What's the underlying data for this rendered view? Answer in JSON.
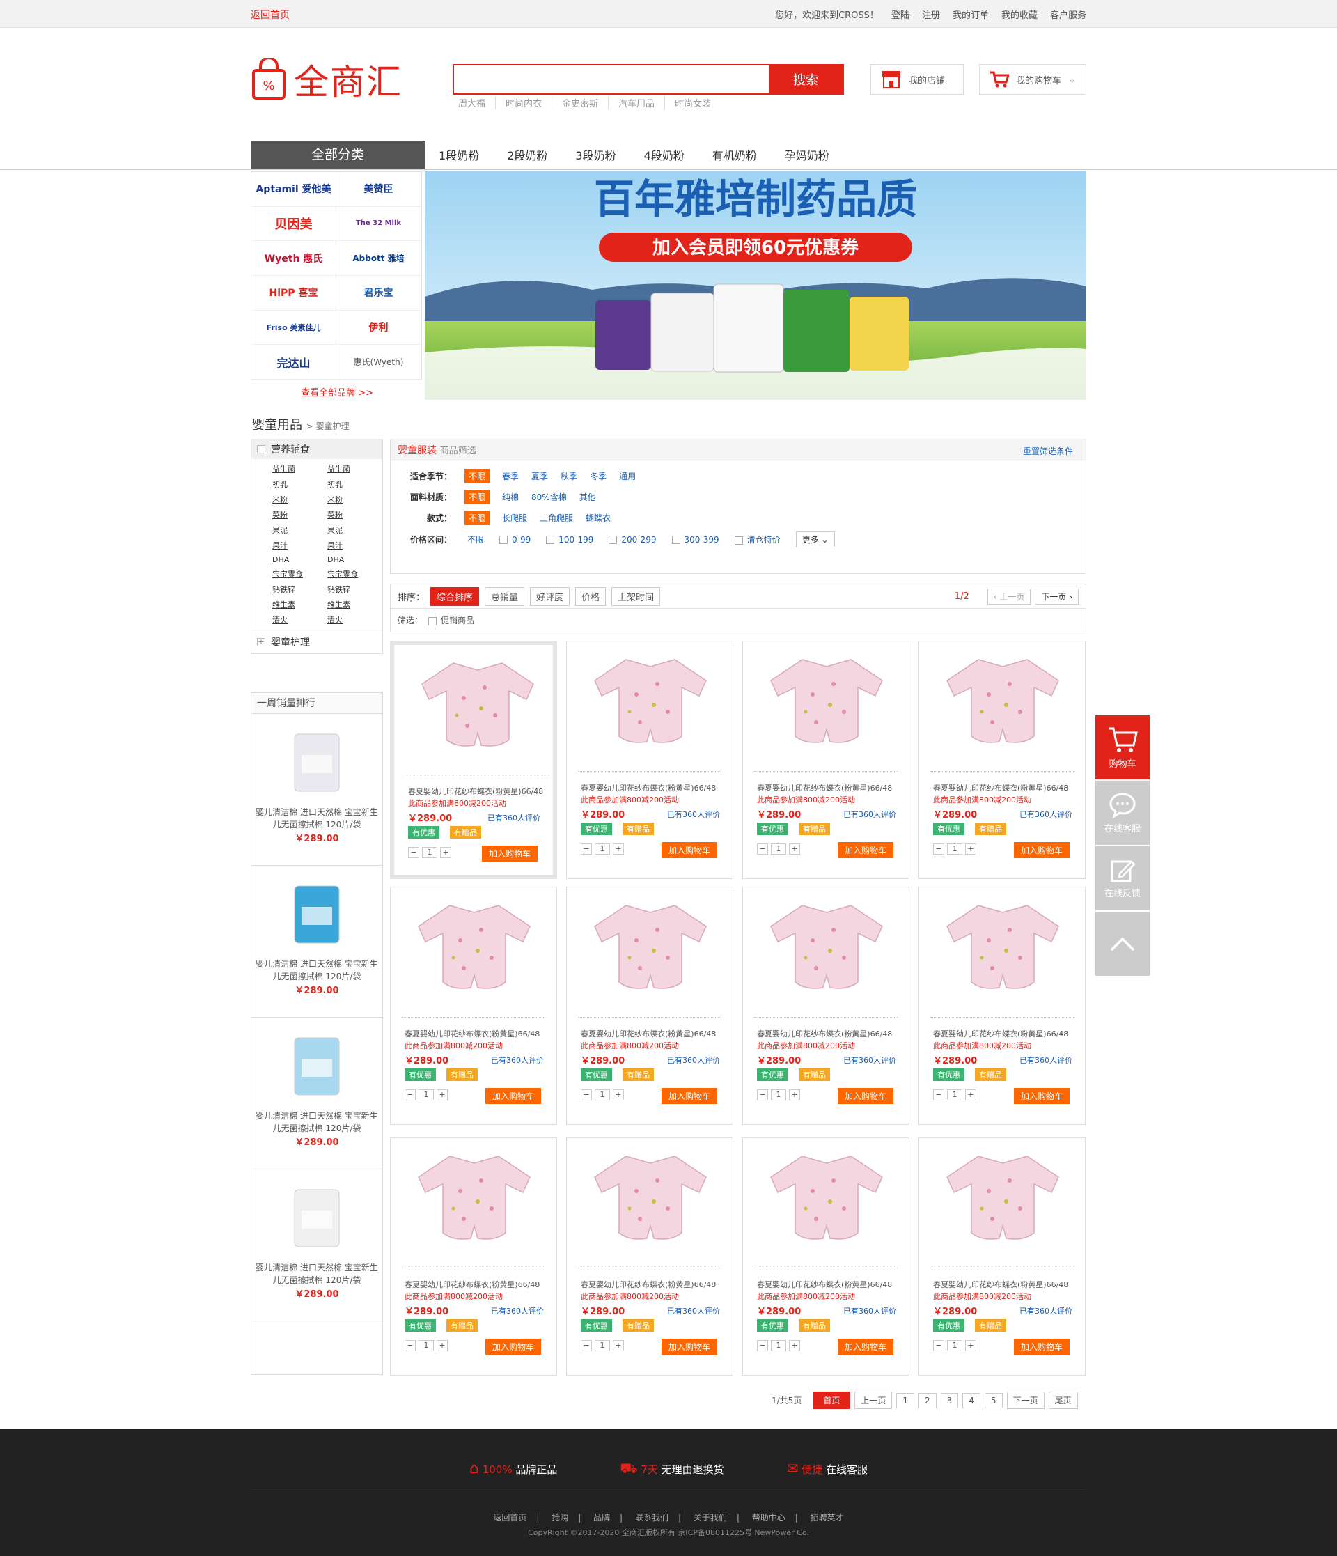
{
  "topbar": {
    "home": "返回首页",
    "welcome": "您好，欢迎来到CROSS！",
    "login": "登陆",
    "register": "注册",
    "orders": "我的订单",
    "favorites": "我的收藏",
    "service": "客户服务"
  },
  "header": {
    "logo": "全商汇",
    "search_button": "搜索",
    "search_placeholder": "",
    "hotwords": [
      "周大福",
      "时尚内衣",
      "金史密斯",
      "汽车用品",
      "时尚女装"
    ],
    "my_shop": "我的店铺",
    "my_cart": "我的购物车"
  },
  "nav": {
    "all": "全部分类",
    "items": [
      "1段奶粉",
      "2段奶粉",
      "3段奶粉",
      "4段奶粉",
      "有机奶粉",
      "孕妈奶粉"
    ]
  },
  "brands": {
    "items": [
      "Aptamil 爱他美",
      "美赞臣",
      "贝因美",
      "The 32 Milk",
      "Wyeth 惠氏",
      "Abbott 雅培",
      "HiPP 喜宝",
      "君乐宝",
      "Friso 美素佳儿",
      "伊利",
      "完达山",
      "惠氏(Wyeth)"
    ],
    "all": "查看全部品牌 >>"
  },
  "banner": {
    "title": "百年雅培制药品质",
    "subtitle": "加入会员即领60元优惠券"
  },
  "breadcrumb": {
    "main": "婴童用品",
    "sub": "婴童护理"
  },
  "leftcat": {
    "title1": "营养辅食",
    "items": [
      "益生菌",
      "益生菌",
      "初乳",
      "初乳",
      "米粉",
      "米粉",
      "菜粉",
      "菜粉",
      "果泥",
      "果泥",
      "果汁",
      "果汁",
      "DHA",
      "DHA",
      "宝宝零食",
      "宝宝零食",
      "钙铁锌",
      "钙铁锌",
      "维生素",
      "维生素",
      "清火",
      "清火"
    ],
    "title2": "婴童护理"
  },
  "rank": {
    "title": "一周销量排行",
    "items": [
      {
        "title": "婴儿清洁棉 进口天然棉 宝宝新生儿无菌擦拭棉 120片/袋",
        "price": "￥289.00"
      },
      {
        "title": "婴儿清洁棉 进口天然棉 宝宝新生儿无菌擦拭棉 120片/袋",
        "price": "￥289.00"
      },
      {
        "title": "婴儿清洁棉 进口天然棉 宝宝新生儿无菌擦拭棉 120片/袋",
        "price": "￥289.00"
      },
      {
        "title": "婴儿清洁棉 进口天然棉 宝宝新生儿无菌擦拭棉 120片/袋",
        "price": "￥289.00"
      }
    ]
  },
  "filter": {
    "title": "婴童服装",
    "subtitle": "-商品筛选",
    "reset": "重置筛选条件",
    "season": {
      "label": "适合季节：",
      "on": "不限",
      "opts": [
        "春季",
        "夏季",
        "秋季",
        "冬季",
        "通用"
      ]
    },
    "material": {
      "label": "面料材质：",
      "on": "不限",
      "opts": [
        "纯棉",
        "80%含棉",
        "其他"
      ]
    },
    "style": {
      "label": "款式：",
      "on": "不限",
      "opts": [
        "长爬服",
        "三角爬服",
        "蝴蝶衣"
      ]
    },
    "price": {
      "label": "价格区间：",
      "first": "不限",
      "opts": [
        "0-99",
        "100-199",
        "200-299",
        "300-399",
        "清仓特价"
      ],
      "more": "更多"
    }
  },
  "sort": {
    "label": "排序：",
    "opts": [
      "综合排序",
      "总销量",
      "好评度",
      "价格",
      "上架时间"
    ],
    "page": "1/2",
    "prev": "上一页",
    "next": "下一页",
    "screen_label": "筛选：",
    "promo": "促销商品"
  },
  "product": {
    "title": "春夏婴幼儿印花纱布蝶衣(粉黄星)66/48",
    "promo": "此商品参加满800减200活动",
    "price": "￥289.00",
    "reviews": "已有360人评价",
    "tag1": "有优惠",
    "tag2": "有赠品",
    "qty": "1",
    "add": "加入购物车",
    "count": 12
  },
  "pager": {
    "info": "1/共5页",
    "first": "首页",
    "prev": "上一页",
    "pages": [
      "1",
      "2",
      "3",
      "4",
      "5"
    ],
    "next": "下一页",
    "last": "尾页"
  },
  "side": {
    "cart": "购物车",
    "chat": "在线客服",
    "feedback": "在线反馈"
  },
  "footer": {
    "f1a": "100%",
    "f1b": "品牌正品",
    "f2a": "7天",
    "f2b": "无理由退换货",
    "f3a": "便捷",
    "f3b": "在线客服",
    "links": [
      "返回首页",
      "抢购",
      "品牌",
      "联系我们",
      "关于我们",
      "帮助中心",
      "招聘英才"
    ],
    "copy": "CopyRight ©2017-2020 全商汇版权所有 京ICP备08011225号 NewPower Co."
  },
  "colors": {
    "accent": "#e2231a",
    "orange": "#ff6600",
    "footer": "#222222"
  }
}
